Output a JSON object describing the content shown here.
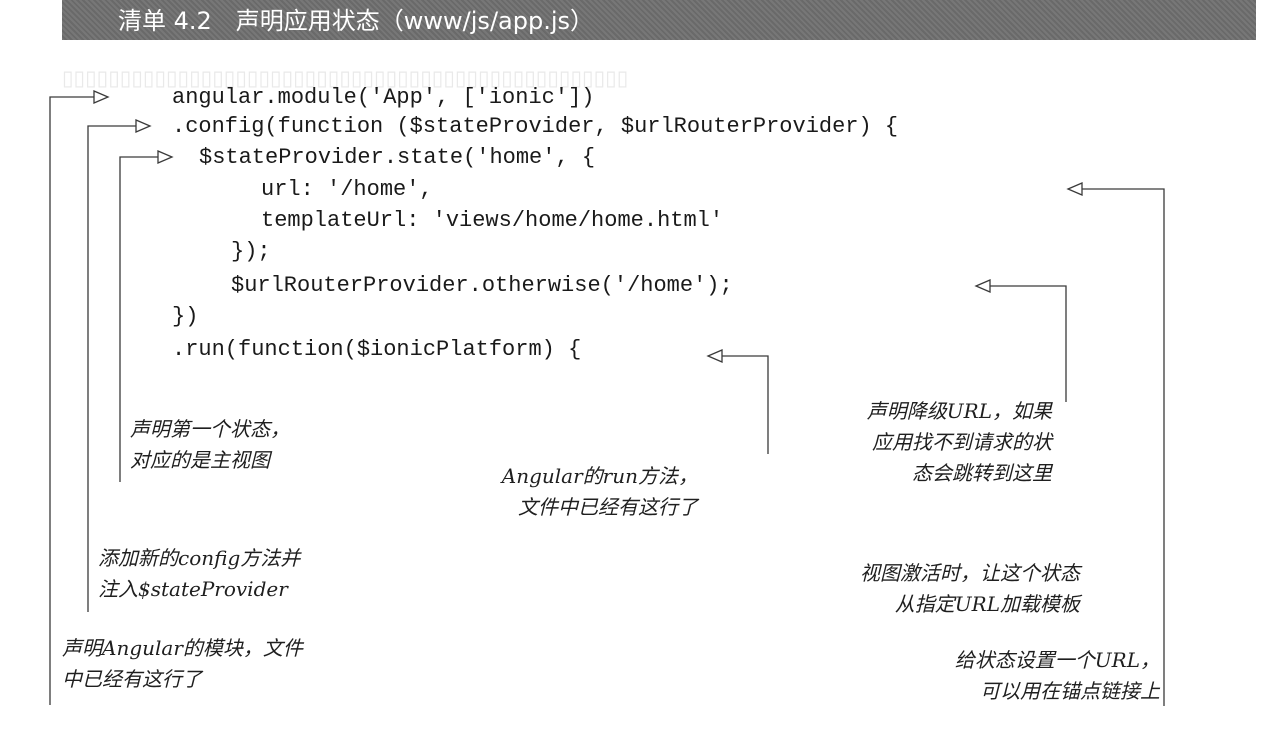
{
  "listing": {
    "title": "清单 4.2　声明应用状态（www/js/app.js）"
  },
  "code_lines": [
    "angular.module('App', ['ionic'])",
    ".config(function ($stateProvider, $urlRouterProvider) {",
    "$stateProvider.state('home', {",
    "url: '/home',",
    "templateUrl: 'views/home/home.html'",
    "});",
    "$urlRouterProvider.otherwise('/home');",
    "})",
    ".run(function($ionicPlatform) {"
  ],
  "annotations": {
    "first_state": [
      "声明第一个状态，",
      "对应的是主视图"
    ],
    "run_method": [
      "Angular的run方法，",
      "文件中已经有这行了"
    ],
    "fallback_url": [
      "声明降级URL，如果",
      "应用找不到请求的状",
      "态会跳转到这里"
    ],
    "config_method": [
      "添加新的config方法并",
      "注入$stateProvider"
    ],
    "template_url": [
      "视图激活时，让这个状态",
      "从指定URL加载模板"
    ],
    "angular_module": [
      "声明Angular的模块，文件",
      "中已经有这行了"
    ],
    "state_url": [
      "给状态设置一个URL，",
      "可以用在锚点链接上"
    ]
  }
}
